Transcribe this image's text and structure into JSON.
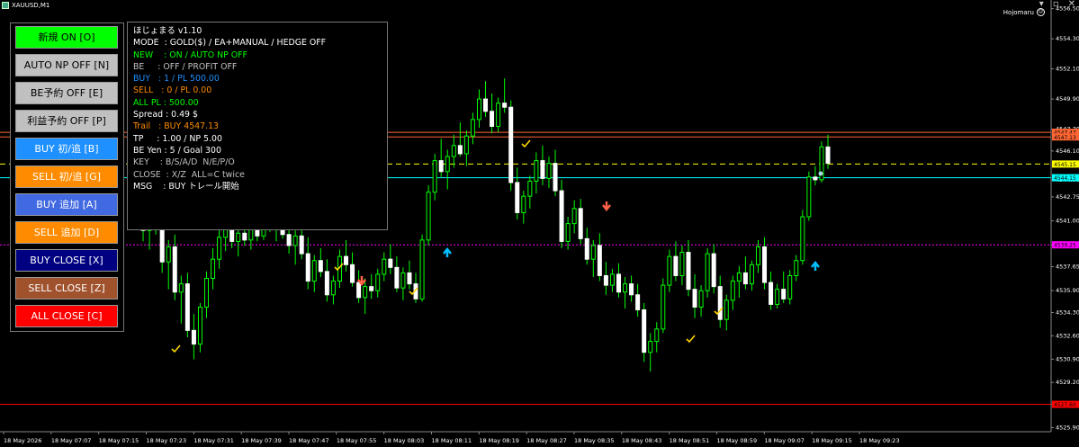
{
  "window": {
    "symbol": "XAUUSD,M1",
    "ea_name": "Hojomaru",
    "buttons": [
      "▾",
      "▫",
      "✕"
    ],
    "colors": {
      "background": "#000000",
      "bull": "#00ff00",
      "bear": "#ffffff",
      "panel_border": "#777777"
    }
  },
  "panel": {
    "buttons": [
      {
        "name": "new-on-button",
        "label": "新規 ON [O]",
        "bg": "#00ff00",
        "fg": "#000000"
      },
      {
        "name": "auto-np-off-button",
        "label": "AUTO NP OFF [N]",
        "bg": "#c0c0c0",
        "fg": "#000000"
      },
      {
        "name": "be-reserve-off-button",
        "label": "BE予約 OFF [E]",
        "bg": "#c0c0c0",
        "fg": "#000000"
      },
      {
        "name": "profit-reserve-off-button",
        "label": "利益予約 OFF [P]",
        "bg": "#c0c0c0",
        "fg": "#000000"
      },
      {
        "name": "buy-initial-add-button",
        "label": "BUY 初/追 [B]",
        "bg": "#1e90ff",
        "fg": "#ffffff"
      },
      {
        "name": "sell-initial-add-button",
        "label": "SELL 初/追 [G]",
        "bg": "#ff8c00",
        "fg": "#ffffff"
      },
      {
        "name": "buy-add-button",
        "label": "BUY 追加 [A]",
        "bg": "#4169e1",
        "fg": "#ffffff"
      },
      {
        "name": "sell-add-button",
        "label": "SELL 追加 [D]",
        "bg": "#ff8c00",
        "fg": "#ffffff"
      },
      {
        "name": "buy-close-button",
        "label": "BUY CLOSE [X]",
        "bg": "#000080",
        "fg": "#ffffff"
      },
      {
        "name": "sell-close-button",
        "label": "SELL CLOSE [Z]",
        "bg": "#a0522d",
        "fg": "#ffffff"
      },
      {
        "name": "all-close-button",
        "label": "ALL CLOSE [C]",
        "bg": "#ff0000",
        "fg": "#ffffff"
      }
    ]
  },
  "info": {
    "lines": [
      {
        "name": "info-title",
        "text": "ほじょまる v1.10",
        "color": "#ffffff"
      },
      {
        "name": "info-mode",
        "text": "MODE  : GOLD($) / EA+MANUAL / HEDGE OFF",
        "color": "#ffffff"
      },
      {
        "name": "info-new",
        "text": "NEW    : ON / AUTO NP OFF",
        "color": "#00ff00"
      },
      {
        "name": "info-be",
        "text": "BE     : OFF / PROFIT OFF",
        "color": "#c0c0c0"
      },
      {
        "name": "info-buy",
        "text": "BUY   : 1 / PL 500.00",
        "color": "#1e90ff"
      },
      {
        "name": "info-sell",
        "text": "SELL   : 0 / PL 0.00",
        "color": "#ff8c00"
      },
      {
        "name": "info-all-pl",
        "text": "ALL PL : 500.00",
        "color": "#00ff00"
      },
      {
        "name": "info-spread",
        "text": "Spread : 0.49 $",
        "color": "#ffffff"
      },
      {
        "name": "info-trail",
        "text": "Trail   : BUY 4547.13",
        "color": "#ff8c00"
      },
      {
        "name": "info-tp",
        "text": "TP     : 1.00 / NP 5.00",
        "color": "#ffffff"
      },
      {
        "name": "info-be-yen",
        "text": "BE Yen : 5 / Goal 300",
        "color": "#ffffff"
      },
      {
        "name": "info-key",
        "text": "KEY    : B/S/A/D  N/E/P/O",
        "color": "#c0c0c0"
      },
      {
        "name": "info-close",
        "text": "CLOSE  : X/Z  ALL=C twice",
        "color": "#c0c0c0"
      },
      {
        "name": "info-msg",
        "text": "MSG    : BUY トレール開始",
        "color": "#ffffff"
      }
    ]
  },
  "price_axis": {
    "ticks": [
      "4556.50",
      "4554.30",
      "4552.10",
      "4549.90",
      "4547.70",
      "4546.10",
      "4544.00",
      "4542.75",
      "4541.00",
      "4539.25",
      "4537.65",
      "4535.90",
      "4534.30",
      "4532.60",
      "4530.90",
      "4529.20",
      "4527.60",
      "4525.90"
    ],
    "levels": [
      {
        "name": "level-high-1",
        "label": "4547.47",
        "color": "#ff6633"
      },
      {
        "name": "level-high-2",
        "label": "4547.13",
        "color": "#ff6633"
      },
      {
        "name": "level-bid",
        "label": "4545.15",
        "color": "#ffff00"
      },
      {
        "name": "level-ask",
        "label": "4544.15",
        "color": "#00ffff"
      },
      {
        "name": "level-magenta",
        "label": "4539.25",
        "color": "#ff00ff"
      },
      {
        "name": "level-red-low",
        "label": "4527.60",
        "color": "#ff0000"
      }
    ]
  },
  "time_axis": {
    "ticks": [
      "18 May 2026",
      "18 May 07:07",
      "18 May 07:15",
      "18 May 07:23",
      "18 May 07:31",
      "18 May 07:39",
      "18 May 07:47",
      "18 May 07:55",
      "18 May 08:03",
      "18 May 08:11",
      "18 May 08:19",
      "18 May 08:27",
      "18 May 08:35",
      "18 May 08:43",
      "18 May 08:51",
      "18 May 08:59",
      "18 May 09:07",
      "18 May 09:15",
      "18 May 09:23"
    ]
  },
  "chart_data": {
    "type": "candlestick",
    "symbol": "XAUUSD",
    "timeframe": "M1",
    "ylim": [
      4525.6,
      4557.0
    ],
    "candles": [
      [
        4543.2,
        4544.5,
        4541.0,
        4542.0
      ],
      [
        4542.0,
        4543.8,
        4539.5,
        4540.3
      ],
      [
        4540.3,
        4541.9,
        4538.9,
        4541.2
      ],
      [
        4541.2,
        4542.5,
        4540.0,
        4540.5
      ],
      [
        4540.5,
        4541.0,
        4537.2,
        4538.0
      ],
      [
        4538.0,
        4539.6,
        4536.0,
        4539.1
      ],
      [
        4539.1,
        4540.0,
        4535.2,
        4535.8
      ],
      [
        4535.8,
        4537.0,
        4533.5,
        4536.4
      ],
      [
        4536.4,
        4537.2,
        4532.5,
        4533.0
      ],
      [
        4533.0,
        4534.2,
        4530.9,
        4532.0
      ],
      [
        4532.0,
        4535.0,
        4531.4,
        4534.7
      ],
      [
        4534.7,
        4537.3,
        4533.9,
        4536.8
      ],
      [
        4536.8,
        4539.0,
        4536.0,
        4538.2
      ],
      [
        4538.2,
        4540.5,
        4537.5,
        4539.8
      ],
      [
        4539.8,
        4541.2,
        4538.8,
        4540.6
      ],
      [
        4540.6,
        4541.5,
        4539.0,
        4539.5
      ],
      [
        4539.5,
        4540.6,
        4538.4,
        4540.1
      ],
      [
        4540.1,
        4541.0,
        4539.2,
        4539.6
      ],
      [
        4539.6,
        4540.8,
        4538.9,
        4540.4
      ],
      [
        4540.4,
        4541.3,
        4539.5,
        4539.9
      ],
      [
        4539.9,
        4541.8,
        4539.6,
        4541.4
      ],
      [
        4541.4,
        4542.0,
        4540.2,
        4540.7
      ],
      [
        4540.7,
        4541.5,
        4539.5,
        4540.9
      ],
      [
        4540.9,
        4541.6,
        4539.7,
        4540.0
      ],
      [
        4540.0,
        4541.0,
        4538.6,
        4539.2
      ],
      [
        4539.2,
        4540.3,
        4537.8,
        4539.9
      ],
      [
        4539.9,
        4540.7,
        4538.2,
        4538.6
      ],
      [
        4538.6,
        4539.8,
        4536.0,
        4536.6
      ],
      [
        4536.6,
        4538.5,
        4535.8,
        4538.1
      ],
      [
        4538.1,
        4539.0,
        4536.9,
        4537.3
      ],
      [
        4537.3,
        4538.2,
        4535.1,
        4535.6
      ],
      [
        4535.6,
        4537.0,
        4534.9,
        4536.6
      ],
      [
        4536.6,
        4538.9,
        4536.1,
        4538.4
      ],
      [
        4538.4,
        4539.6,
        4537.3,
        4537.8
      ],
      [
        4537.8,
        4538.7,
        4536.2,
        4536.5
      ],
      [
        4536.5,
        4537.4,
        4535.0,
        4535.4
      ],
      [
        4535.4,
        4536.8,
        4534.2,
        4536.2
      ],
      [
        4536.2,
        4537.1,
        4535.3,
        4535.9
      ],
      [
        4535.9,
        4537.5,
        4535.4,
        4537.1
      ],
      [
        4537.1,
        4538.7,
        4536.6,
        4538.2
      ],
      [
        4538.2,
        4539.3,
        4537.1,
        4537.6
      ],
      [
        4537.6,
        4538.4,
        4535.8,
        4536.1
      ],
      [
        4536.1,
        4537.6,
        4535.2,
        4537.2
      ],
      [
        4537.2,
        4538.1,
        4536.0,
        4536.4
      ],
      [
        4536.4,
        4537.2,
        4535.0,
        4535.3
      ],
      [
        4535.3,
        4540.0,
        4535.1,
        4539.6
      ],
      [
        4539.6,
        4543.6,
        4539.2,
        4543.1
      ],
      [
        4543.1,
        4545.9,
        4542.5,
        4545.4
      ],
      [
        4545.4,
        4547.0,
        4544.2,
        4544.6
      ],
      [
        4544.6,
        4546.2,
        4543.3,
        4545.7
      ],
      [
        4545.7,
        4547.3,
        4544.9,
        4546.5
      ],
      [
        4546.5,
        4548.2,
        4545.7,
        4545.9
      ],
      [
        4545.9,
        4547.6,
        4545.0,
        4547.2
      ],
      [
        4547.2,
        4548.9,
        4546.6,
        4548.4
      ],
      [
        4548.4,
        4550.6,
        4547.8,
        4549.9
      ],
      [
        4549.9,
        4551.2,
        4548.6,
        4549.0
      ],
      [
        4549.0,
        4550.3,
        4547.4,
        4547.9
      ],
      [
        4547.9,
        4550.0,
        4547.5,
        4549.6
      ],
      [
        4549.6,
        4551.4,
        4548.9,
        4549.3
      ],
      [
        4549.3,
        4549.8,
        4543.2,
        4543.8
      ],
      [
        4543.8,
        4544.9,
        4541.1,
        4541.6
      ],
      [
        4541.6,
        4543.2,
        4540.8,
        4542.8
      ],
      [
        4542.8,
        4544.3,
        4541.9,
        4543.9
      ],
      [
        4543.9,
        4546.0,
        4543.0,
        4545.4
      ],
      [
        4545.4,
        4546.5,
        4543.6,
        4544.1
      ],
      [
        4544.1,
        4545.7,
        4543.4,
        4545.2
      ],
      [
        4545.2,
        4546.2,
        4542.8,
        4543.2
      ],
      [
        4543.2,
        4544.0,
        4539.0,
        4539.5
      ],
      [
        4539.5,
        4541.3,
        4538.9,
        4540.8
      ],
      [
        4540.8,
        4542.5,
        4540.1,
        4541.9
      ],
      [
        4541.9,
        4542.6,
        4539.3,
        4539.7
      ],
      [
        4539.7,
        4540.5,
        4537.8,
        4538.2
      ],
      [
        4538.2,
        4539.6,
        4536.9,
        4539.2
      ],
      [
        4539.2,
        4540.1,
        4536.6,
        4537.0
      ],
      [
        4537.0,
        4538.0,
        4535.6,
        4536.3
      ],
      [
        4536.3,
        4537.5,
        4535.8,
        4537.1
      ],
      [
        4537.1,
        4537.9,
        4535.4,
        4535.8
      ],
      [
        4535.8,
        4536.9,
        4534.6,
        4536.4
      ],
      [
        4536.4,
        4537.0,
        4535.1,
        4535.6
      ],
      [
        4535.6,
        4536.4,
        4534.0,
        4534.5
      ],
      [
        4534.5,
        4535.0,
        4530.7,
        4531.4
      ],
      [
        4531.4,
        4532.8,
        4530.0,
        4532.2
      ],
      [
        4532.2,
        4533.6,
        4531.4,
        4533.1
      ],
      [
        4533.1,
        4536.8,
        4532.8,
        4536.3
      ],
      [
        4536.3,
        4538.9,
        4535.8,
        4538.4
      ],
      [
        4538.4,
        4539.5,
        4536.6,
        4537.0
      ],
      [
        4537.0,
        4539.2,
        4536.3,
        4538.7
      ],
      [
        4538.7,
        4539.6,
        4535.5,
        4536.0
      ],
      [
        4536.0,
        4537.1,
        4533.9,
        4534.7
      ],
      [
        4534.7,
        4536.3,
        4534.0,
        4535.9
      ],
      [
        4535.9,
        4539.0,
        4535.4,
        4538.6
      ],
      [
        4538.6,
        4539.3,
        4535.7,
        4536.2
      ],
      [
        4536.2,
        4537.0,
        4533.2,
        4533.8
      ],
      [
        4533.8,
        4535.6,
        4533.0,
        4535.2
      ],
      [
        4535.2,
        4537.0,
        4534.5,
        4536.6
      ],
      [
        4536.6,
        4537.7,
        4535.4,
        4537.2
      ],
      [
        4537.2,
        4538.4,
        4536.0,
        4536.4
      ],
      [
        4536.4,
        4538.1,
        4535.9,
        4537.8
      ],
      [
        4537.8,
        4539.6,
        4537.2,
        4539.1
      ],
      [
        4539.1,
        4539.8,
        4536.0,
        4536.5
      ],
      [
        4536.5,
        4537.3,
        4534.5,
        4534.9
      ],
      [
        4534.9,
        4536.4,
        4534.6,
        4536.0
      ],
      [
        4536.0,
        4537.3,
        4535.0,
        4535.3
      ],
      [
        4535.3,
        4537.4,
        4534.9,
        4537.0
      ],
      [
        4537.0,
        4538.5,
        4536.6,
        4538.1
      ],
      [
        4538.1,
        4541.8,
        4537.8,
        4541.3
      ],
      [
        4541.3,
        4544.6,
        4541.0,
        4544.2
      ],
      [
        4544.2,
        4545.0,
        4543.6,
        4544.0
      ],
      [
        4544.0,
        4546.8,
        4543.8,
        4546.4
      ],
      [
        4546.4,
        4547.3,
        4544.8,
        4545.2
      ]
    ]
  }
}
